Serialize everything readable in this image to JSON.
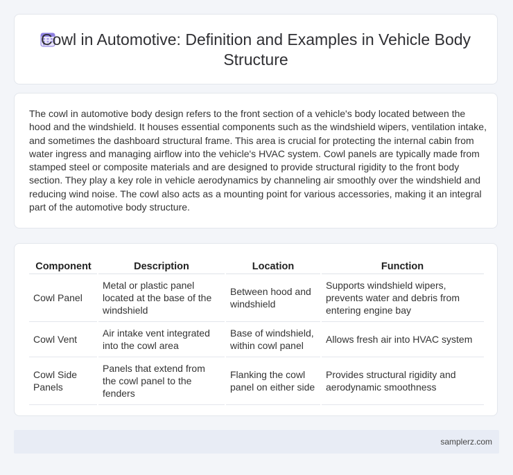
{
  "header": {
    "title": "Cowl in Automotive: Definition and Examples in Vehicle Body Structure",
    "icon": "calendar-icon"
  },
  "intro": {
    "text": "The cowl in automotive body design refers to the front section of a vehicle's body located between the hood and the windshield. It houses essential components such as the windshield wipers, ventilation intake, and sometimes the dashboard structural frame. This area is crucial for protecting the internal cabin from water ingress and managing airflow into the vehicle's HVAC system. Cowl panels are typically made from stamped steel or composite materials and are designed to provide structural rigidity to the front body section. They play a key role in vehicle aerodynamics by channeling air smoothly over the windshield and reducing wind noise. The cowl also acts as a mounting point for various accessories, making it an integral part of the automotive body structure."
  },
  "table": {
    "headers": [
      "Component",
      "Description",
      "Location",
      "Function"
    ],
    "rows": [
      [
        "Cowl Panel",
        "Metal or plastic panel located at the base of the windshield",
        "Between hood and windshield",
        "Supports windshield wipers, prevents water and debris from entering engine bay"
      ],
      [
        "Cowl Vent",
        "Air intake vent integrated into the cowl area",
        "Base of windshield, within cowl panel",
        "Allows fresh air into HVAC system"
      ],
      [
        "Cowl Side Panels",
        "Panels that extend from the cowl panel to the fenders",
        "Flanking the cowl panel on either side",
        "Provides structural rigidity and aerodynamic smoothness"
      ]
    ]
  },
  "footer": {
    "text": "samplerz.com"
  },
  "colors": {
    "accent": "#7b6fd6",
    "background": "#f3f5f9",
    "footer": "#e8ecf5"
  }
}
